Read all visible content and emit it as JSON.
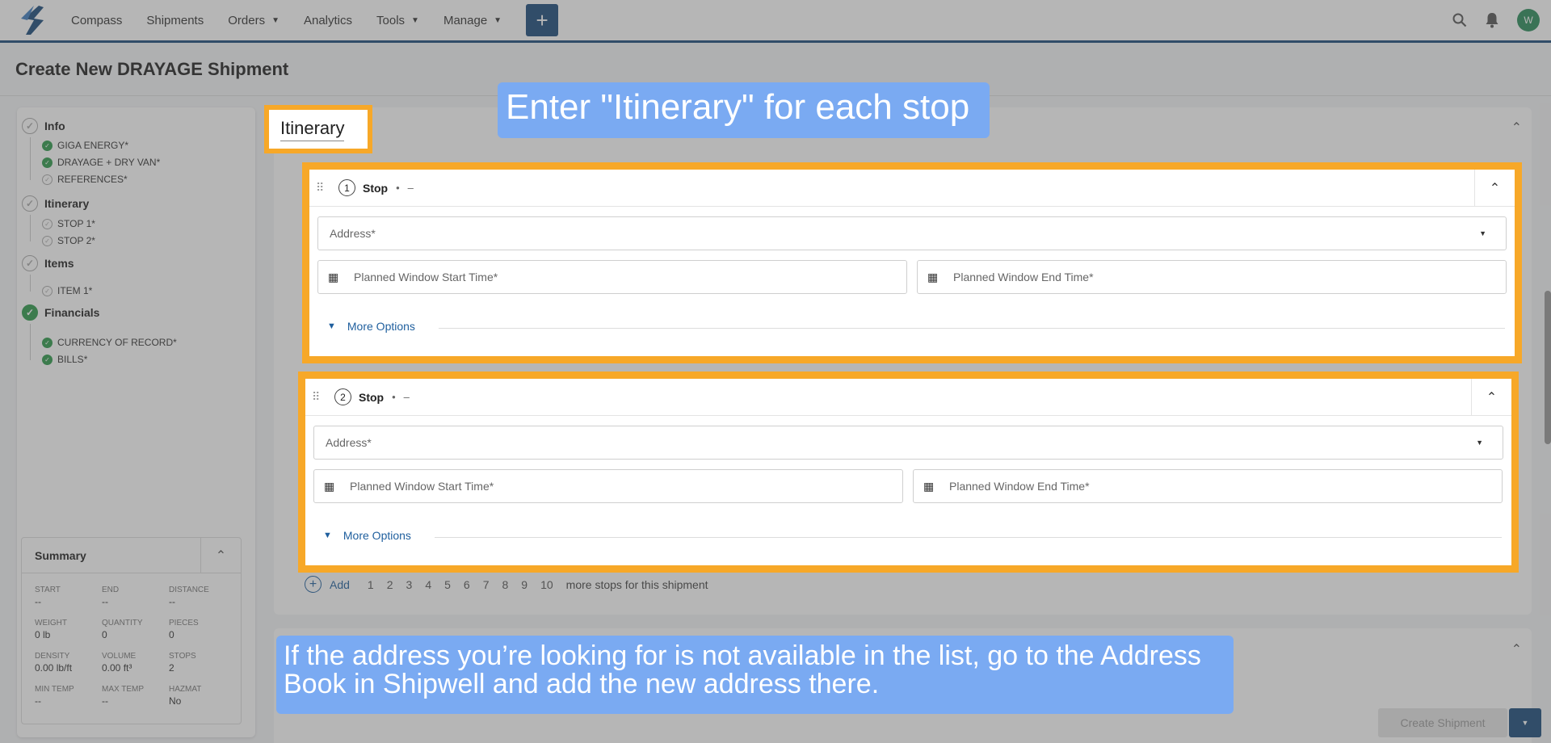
{
  "nav": {
    "items": [
      {
        "label": "Compass",
        "dropdown": false
      },
      {
        "label": "Shipments",
        "dropdown": false
      },
      {
        "label": "Orders",
        "dropdown": true
      },
      {
        "label": "Analytics",
        "dropdown": false
      },
      {
        "label": "Tools",
        "dropdown": true
      },
      {
        "label": "Manage",
        "dropdown": true
      }
    ],
    "avatar_initial": "W",
    "icons": [
      "logo",
      "plus-icon",
      "search-icon",
      "bell-icon"
    ]
  },
  "page_title": "Create New DRAYAGE Shipment",
  "sidebar": {
    "sections": [
      {
        "label": "Info",
        "done": false,
        "items": [
          {
            "label": "GIGA ENERGY*",
            "done": true
          },
          {
            "label": "DRAYAGE + DRY VAN*",
            "done": true
          },
          {
            "label": "REFERENCES*",
            "done": false
          }
        ]
      },
      {
        "label": "Itinerary",
        "done": false,
        "items": [
          {
            "label": "STOP 1*",
            "done": false
          },
          {
            "label": "STOP 2*",
            "done": false
          }
        ]
      },
      {
        "label": "Items",
        "done": false,
        "items": [
          {
            "label": "ITEM 1*",
            "done": false
          }
        ]
      },
      {
        "label": "Financials",
        "done": true,
        "items": [
          {
            "label": "CURRENCY OF RECORD*",
            "done": true
          },
          {
            "label": "BILLS*",
            "done": true
          }
        ]
      }
    ]
  },
  "summary": {
    "title": "Summary",
    "fields": [
      {
        "label": "START",
        "value": "--"
      },
      {
        "label": "END",
        "value": "--"
      },
      {
        "label": "DISTANCE",
        "value": "--"
      },
      {
        "label": "WEIGHT",
        "value": "0 lb"
      },
      {
        "label": "QUANTITY",
        "value": "0"
      },
      {
        "label": "PIECES",
        "value": "0"
      },
      {
        "label": "DENSITY",
        "value": "0.00 lb/ft"
      },
      {
        "label": "VOLUME",
        "value": "0.00 ft³"
      },
      {
        "label": "STOPS",
        "value": "2"
      },
      {
        "label": "MIN TEMP",
        "value": "--"
      },
      {
        "label": "MAX TEMP",
        "value": "--"
      },
      {
        "label": "HAZMAT",
        "value": "No"
      }
    ]
  },
  "itinerary": {
    "label": "Itinerary",
    "stops": [
      {
        "number": "1",
        "name": "Stop",
        "sep": "•",
        "detail": "–",
        "address_placeholder": "Address*",
        "start_placeholder": "Planned Window Start Time*",
        "end_placeholder": "Planned Window End Time*",
        "more_options": "More Options"
      },
      {
        "number": "2",
        "name": "Stop",
        "sep": "•",
        "detail": "–",
        "address_placeholder": "Address*",
        "start_placeholder": "Planned Window Start Time*",
        "end_placeholder": "Planned Window End Time*",
        "more_options": "More Options"
      }
    ],
    "add_label": "Add",
    "add_numbers": [
      "1",
      "2",
      "3",
      "4",
      "5",
      "6",
      "7",
      "8",
      "9",
      "10"
    ],
    "add_tail": "more stops for this shipment"
  },
  "footer": {
    "create_label": "Create Shipment"
  },
  "callouts": {
    "top": "Enter \"Itinerary\" for each stop",
    "bottom": "If the address you’re looking for is not available in the list, go to the Address Book in Shipwell and add the new address there."
  },
  "colors": {
    "highlight": "#f7a828",
    "callout": "#7aaaf2",
    "brand": "#1b4a7a",
    "success": "#2e9a4b"
  }
}
